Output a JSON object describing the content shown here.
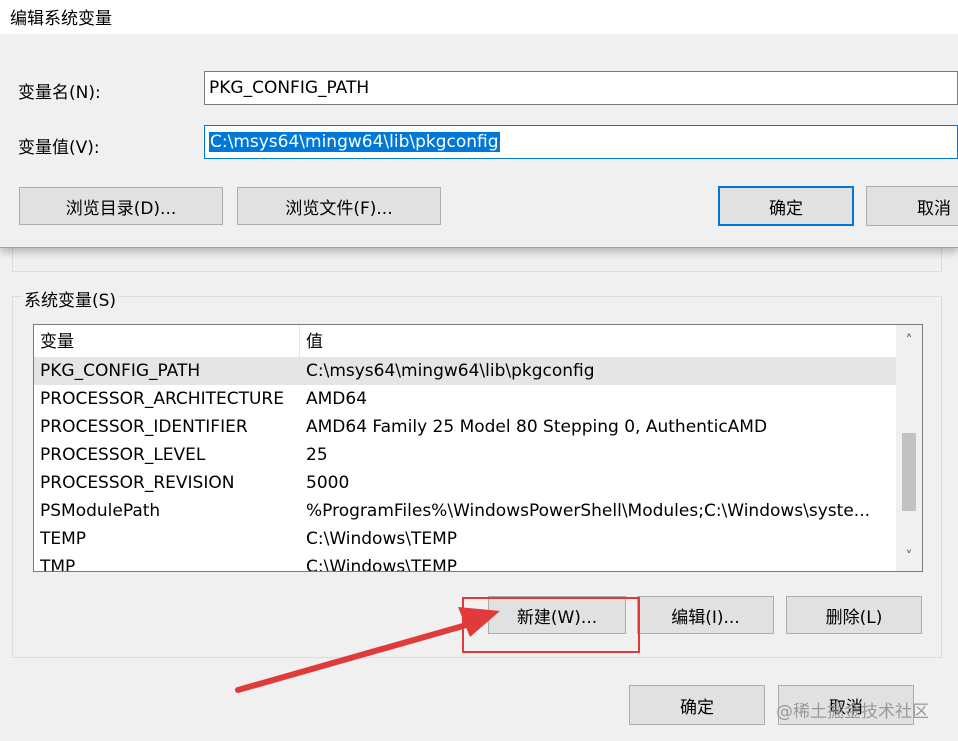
{
  "edit_dialog": {
    "title": "编辑系统变量",
    "name_label": "变量名(N):",
    "name_value": "PKG_CONFIG_PATH",
    "value_label": "变量值(V):",
    "value_value": "C:\\msys64\\mingw64\\lib\\pkgconfig",
    "browse_dir_label": "浏览目录(D)...",
    "browse_file_label": "浏览文件(F)...",
    "ok_label": "确定",
    "cancel_label": "取消"
  },
  "system_vars": {
    "group_label": "系统变量(S)",
    "col_variable": "变量",
    "col_value": "值",
    "rows": [
      {
        "name": "PKG_CONFIG_PATH",
        "value": "C:\\msys64\\mingw64\\lib\\pkgconfig"
      },
      {
        "name": "PROCESSOR_ARCHITECTURE",
        "value": "AMD64"
      },
      {
        "name": "PROCESSOR_IDENTIFIER",
        "value": "AMD64 Family 25 Model 80 Stepping 0, AuthenticAMD"
      },
      {
        "name": "PROCESSOR_LEVEL",
        "value": "25"
      },
      {
        "name": "PROCESSOR_REVISION",
        "value": "5000"
      },
      {
        "name": "PSModulePath",
        "value": "%ProgramFiles%\\WindowsPowerShell\\Modules;C:\\Windows\\syste..."
      },
      {
        "name": "TEMP",
        "value": "C:\\Windows\\TEMP"
      },
      {
        "name": "TMP",
        "value": "C:\\Windows\\TEMP"
      }
    ],
    "new_label": "新建(W)...",
    "edit_label": "编辑(I)...",
    "delete_label": "删除(L)"
  },
  "footer": {
    "ok_label": "确定",
    "cancel_label": "取消"
  },
  "watermark": "@稀土掘金技术社区",
  "icons": {
    "scroll_up": "chevron-up-icon",
    "scroll_down": "chevron-down-icon"
  },
  "colors": {
    "accent": "#0078d7",
    "annotation_red": "#e03a3a"
  }
}
